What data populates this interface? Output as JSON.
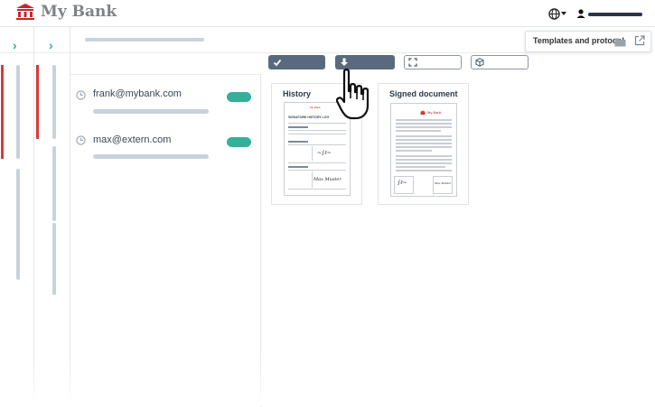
{
  "header": {
    "brand_name": "My Bank",
    "brand_color": "#c62828",
    "globe_icon": "globe-icon",
    "user_icon": "user-icon"
  },
  "templates_panel": {
    "label": "Templates and protocol",
    "icons": [
      "folder-icon",
      "external-link-icon"
    ]
  },
  "toolbar": {
    "buttons": [
      {
        "icon": "check-icon"
      },
      {
        "icon": "download-icon"
      },
      {
        "icon": "fullscreen-icon"
      },
      {
        "icon": "cube-icon"
      }
    ]
  },
  "signers": [
    {
      "email": "frank@mybank.com",
      "status_color": "#34b09a"
    },
    {
      "email": "max@extern.com",
      "status_color": "#34b09a"
    }
  ],
  "documents": [
    {
      "title": "History",
      "thumb_heading": "SIGNATURE HISTORY LOG",
      "thumb_brand": "My Bank",
      "signature_text": "Max Muster"
    },
    {
      "title": "Signed document",
      "thumb_brand": "My Bank",
      "signature_text": "Max Muster"
    }
  ],
  "colors": {
    "accent": "#34b09a",
    "rail_marker": "#d63a3a",
    "button_dark": "#5a6a7e"
  }
}
